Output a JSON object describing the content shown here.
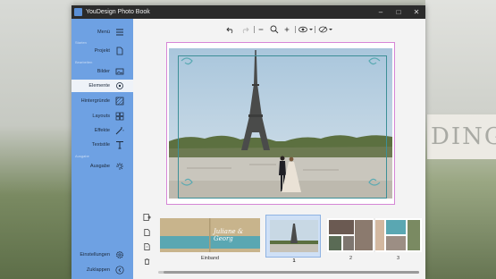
{
  "window": {
    "title": "YouDesign Photo Book",
    "controls": [
      "minimize-icon",
      "maximize-icon",
      "close-icon"
    ]
  },
  "sidebar": {
    "menu_label": "Menü",
    "sections": {
      "start": "Starten",
      "edit": "Bearbeiten",
      "output": "Ausgabe"
    },
    "items": [
      {
        "label": "Projekt",
        "icon": "document-icon"
      },
      {
        "label": "Bilder",
        "icon": "image-icon"
      },
      {
        "label": "Elemente",
        "icon": "elements-icon",
        "active": true
      },
      {
        "label": "Hintergründe",
        "icon": "background-icon"
      },
      {
        "label": "Layouts",
        "icon": "layouts-icon"
      },
      {
        "label": "Effekte",
        "icon": "magic-wand-icon"
      },
      {
        "label": "Textstile",
        "icon": "text-style-icon"
      },
      {
        "label": "Ausgabe",
        "icon": "output-icon"
      }
    ],
    "settings_label": "Einstellungen",
    "collapse_label": "Zuklappen"
  },
  "toolbar": {
    "icons": [
      "undo-icon",
      "redo-icon",
      "zoom-out-icon",
      "zoom-icon",
      "zoom-in-icon",
      "view-icon",
      "preview-icon"
    ]
  },
  "canvas": {
    "photo_description_icon": "eiffel-tower-couple-photo"
  },
  "pages": {
    "labels": [
      "Einband",
      "1",
      "2",
      "3"
    ],
    "cover_text": "Juliane & Georg",
    "selected_page": "1"
  },
  "colors": {
    "sidebar": "#6ea1e3",
    "accent_teal": "#3d8f97",
    "selection": "#d686d6",
    "cover_tan": "#c8b48c",
    "cover_teal": "#5aa7b2"
  }
}
